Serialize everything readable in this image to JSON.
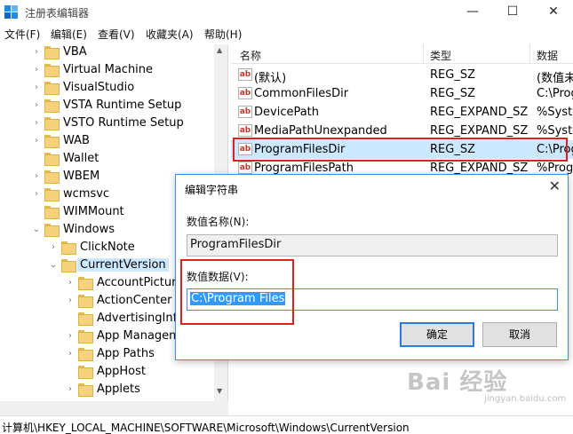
{
  "window": {
    "title": "注册表编辑器",
    "min_glyph": "—",
    "max_glyph": "☐",
    "close_glyph": "✕"
  },
  "menu": [
    "文件(F)",
    "编辑(E)",
    "查看(V)",
    "收藏夹(A)",
    "帮助(H)"
  ],
  "tree": {
    "items": [
      {
        "label": "VBA",
        "level": 2,
        "expander": "›"
      },
      {
        "label": "Virtual Machine",
        "level": 2,
        "expander": "›"
      },
      {
        "label": "VisualStudio",
        "level": 2,
        "expander": "›"
      },
      {
        "label": "VSTA Runtime Setup",
        "level": 2,
        "expander": "›"
      },
      {
        "label": "VSTO Runtime Setup",
        "level": 2,
        "expander": "›"
      },
      {
        "label": "WAB",
        "level": 2,
        "expander": "›"
      },
      {
        "label": "Wallet",
        "level": 2,
        "expander": ""
      },
      {
        "label": "WBEM",
        "level": 2,
        "expander": "›"
      },
      {
        "label": "wcmsvc",
        "level": 2,
        "expander": "›"
      },
      {
        "label": "WIMMount",
        "level": 2,
        "expander": ""
      },
      {
        "label": "Windows",
        "level": 2,
        "expander": "⌄"
      },
      {
        "label": "ClickNote",
        "level": 3,
        "expander": "›"
      },
      {
        "label": "CurrentVersion",
        "level": 3,
        "expander": "⌄",
        "selected": true
      },
      {
        "label": "AccountPicture",
        "level": 4,
        "expander": "›"
      },
      {
        "label": "ActionCenter",
        "level": 4,
        "expander": "›"
      },
      {
        "label": "AdvertisingInfo",
        "level": 4,
        "expander": ""
      },
      {
        "label": "App Managem",
        "level": 4,
        "expander": "›"
      },
      {
        "label": "App Paths",
        "level": 4,
        "expander": "›"
      },
      {
        "label": "AppHost",
        "level": 4,
        "expander": ""
      },
      {
        "label": "Applets",
        "level": 4,
        "expander": "›"
      }
    ]
  },
  "list": {
    "columns": [
      "名称",
      "类型",
      "数据"
    ],
    "rows": [
      {
        "name": "(默认)",
        "type": "REG_SZ",
        "data": "(数值未"
      },
      {
        "name": "CommonFilesDir",
        "type": "REG_SZ",
        "data": "C:\\Prog"
      },
      {
        "name": "DevicePath",
        "type": "REG_EXPAND_SZ",
        "data": "%Syste"
      },
      {
        "name": "MediaPathUnexpanded",
        "type": "REG_EXPAND_SZ",
        "data": "%Syste"
      },
      {
        "name": "ProgramFilesDir",
        "type": "REG_SZ",
        "data": "C:\\Prog",
        "selected": true
      },
      {
        "name": "ProgramFilesPath",
        "type": "REG_EXPAND_SZ",
        "data": "%Prog"
      }
    ],
    "icon_text": "ab"
  },
  "dialog": {
    "title": "编辑字符串",
    "name_label": "数值名称(N):",
    "name_value": "ProgramFilesDir",
    "data_label": "数值数据(V):",
    "data_value": "C:\\Program Files",
    "ok_label": "确定",
    "cancel_label": "取消"
  },
  "statusbar": {
    "path": "计算机\\HKEY_LOCAL_MACHINE\\SOFTWARE\\Microsoft\\Windows\\CurrentVersion"
  },
  "watermark": {
    "text": "Bai 经验",
    "sub": "jingyan.baidu.com"
  },
  "colors": {
    "accent": "#3399ff",
    "selection": "#cce8ff",
    "annotation_red": "#e02020"
  }
}
